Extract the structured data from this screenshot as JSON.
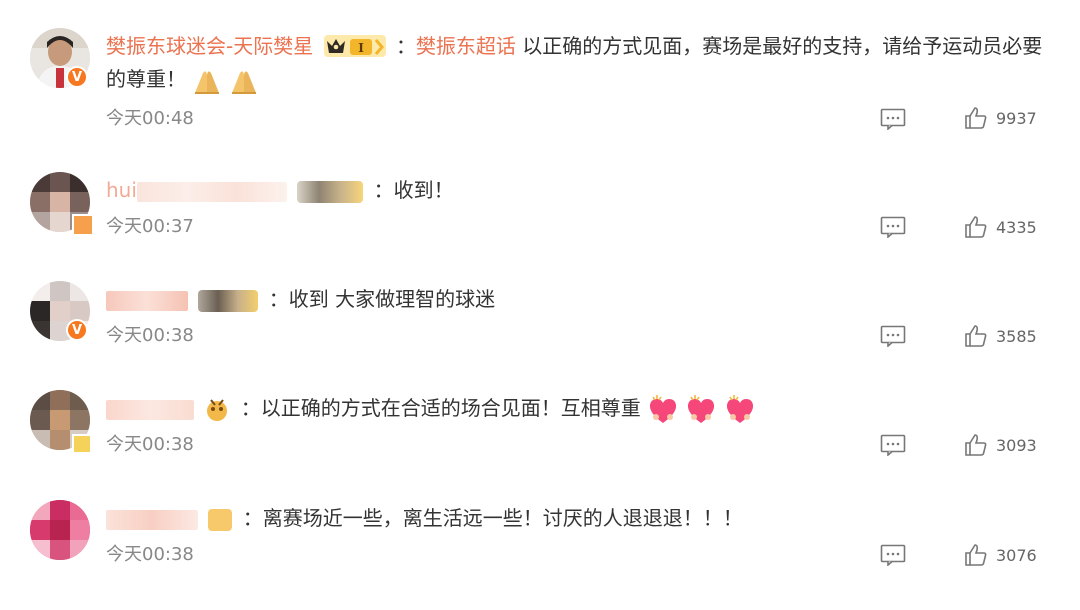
{
  "comments": [
    {
      "username": "樊振东球迷会-天际樊星",
      "badge_label": "I",
      "colon": "：",
      "topic": "樊振东超话",
      "text": " 以正确的方式见面，赛场是最好的支持，请给予运动员必要的尊重！",
      "emojis": [
        "praying-hands",
        "praying-hands"
      ],
      "time": "今天00:48",
      "likes": "9937"
    },
    {
      "username": "hui",
      "colon": "：",
      "text": "收到！",
      "time": "今天00:37",
      "likes": "4335"
    },
    {
      "colon": "：",
      "text": "收到 大家做理智的球迷",
      "time": "今天00:38",
      "likes": "3585"
    },
    {
      "colon": "：",
      "text": "以正确的方式在合适的场合见面！互相尊重",
      "emojis": [
        "heart-face",
        "heart-face",
        "heart-face"
      ],
      "time": "今天00:38",
      "likes": "3093"
    },
    {
      "colon": "：",
      "text": "离赛场近一些，离生活远一些！讨厌的人退退退！！！",
      "time": "今天00:38",
      "likes": "3076"
    }
  ],
  "colors": {
    "username": "#eb7350",
    "verified": "#f7781f",
    "time": "#888888"
  }
}
